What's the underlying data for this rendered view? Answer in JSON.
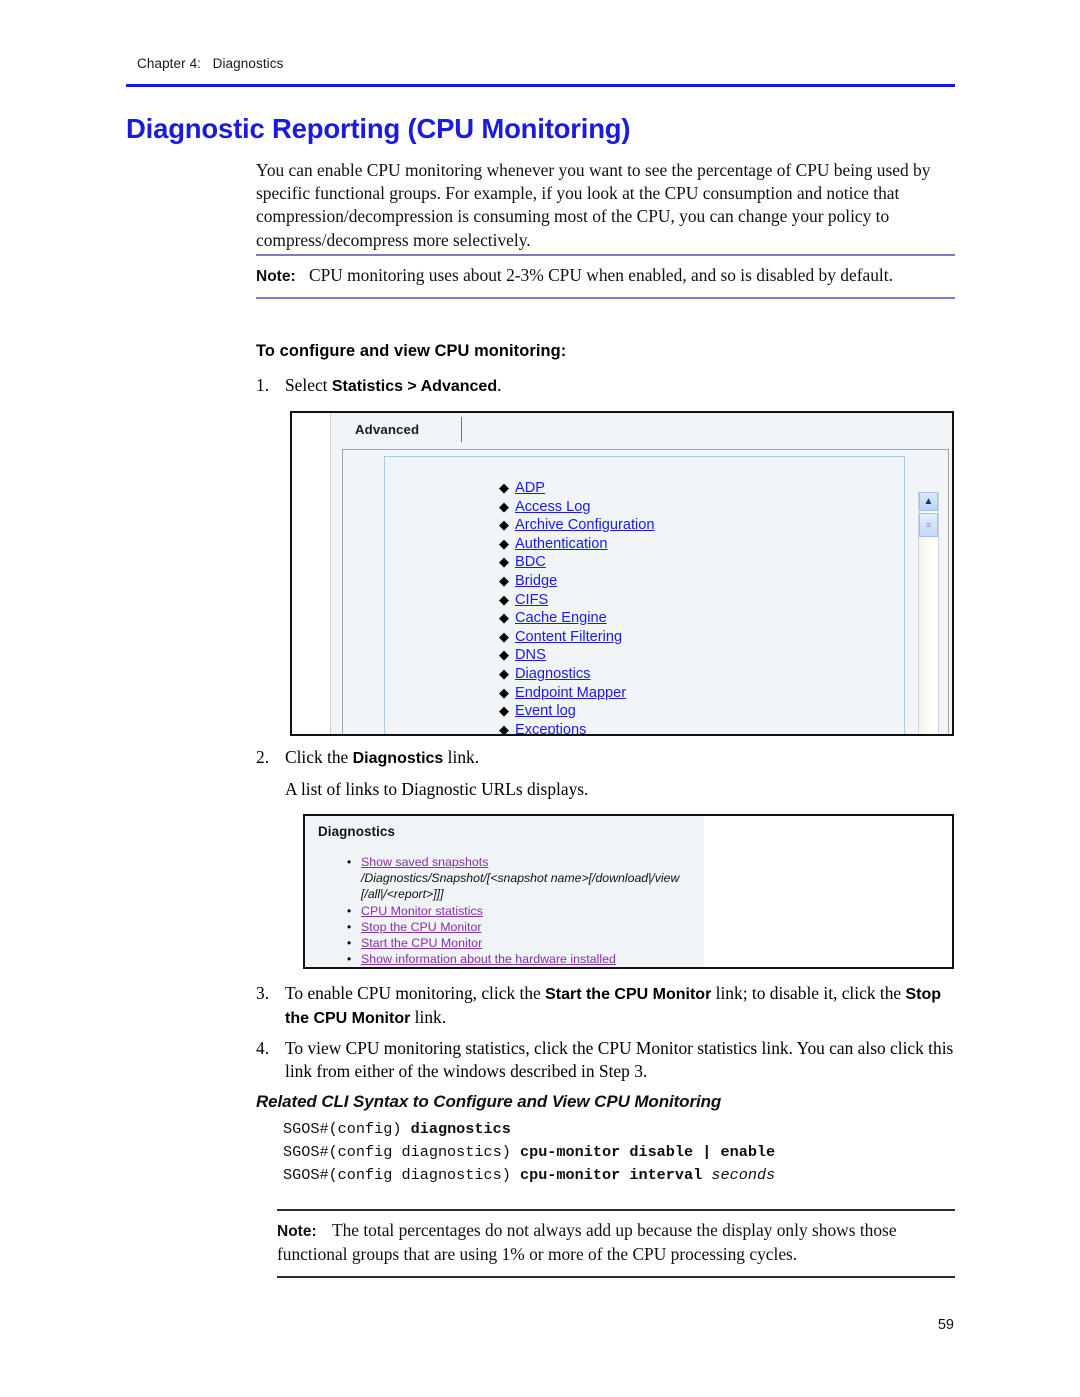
{
  "header": {
    "chapter": "Chapter 4:   Diagnostics",
    "rule_color": "#1414ef"
  },
  "title": "Diagnostic Reporting (CPU Monitoring)",
  "intro_paragraph": "You can enable CPU monitoring whenever you want to see the percentage of CPU being used by specific functional groups. For example, if you look at the CPU consumption and notice that compression/decompression is consuming most of the CPU, you can change your policy to compress/decompress more selectively.",
  "note_top": {
    "label": "Note:",
    "text": "CPU monitoring uses about 2-3% CPU when enabled, and so is disabled by default.",
    "rule_color": "#7b7bc8"
  },
  "subhead": "To configure and view CPU monitoring:",
  "steps": [
    {
      "num": "1.",
      "pre": "Select ",
      "bold": "Statistics > Advanced",
      "post": "."
    },
    {
      "num": "2.",
      "pre": "Click the ",
      "bold": "Diagnostics",
      "post": " link."
    },
    {
      "num": "3.",
      "pre": "To enable CPU monitoring, click the ",
      "bold": "Start the CPU Monitor",
      "mid": " link; to disable it, click the ",
      "bold2": "Stop the CPU Monitor",
      "post": " link."
    },
    {
      "num": "4.",
      "pre": "To view CPU monitoring statistics, click the CPU Monitor statistics link. You can also click this link from either of the windows described in Step 3.",
      "bold": "",
      "post": ""
    }
  ],
  "step2_caption": "A list of links to Diagnostic URLs displays.",
  "figure_advanced": {
    "tab_label": "Advanced",
    "link_color": "#1b1be0",
    "links": [
      "ADP",
      "Access Log",
      "Archive Configuration",
      "Authentication",
      "BDC",
      "Bridge",
      "CIFS",
      "Cache Engine",
      "Content Filtering",
      "DNS",
      "Diagnostics",
      "Endpoint Mapper",
      "Event log",
      "Exceptions"
    ],
    "scrollbar": {
      "up_glyph": "▲",
      "thumb_glyph": "≡"
    }
  },
  "figure_diagnostics": {
    "title": "Diagnostics",
    "link_color": "#8a2fa8",
    "items": [
      {
        "label": "Show saved snapshots",
        "detail_line_1": "/Diagnostics/Snapshot/[<snapshot name>[/download|/view",
        "detail_line_2": "[/all|/<report>]]]"
      },
      {
        "label": "CPU Monitor statistics",
        "detail_line_1": "",
        "detail_line_2": ""
      },
      {
        "label": "Stop the CPU Monitor",
        "detail_line_1": "",
        "detail_line_2": ""
      },
      {
        "label": "Start the CPU Monitor",
        "detail_line_1": "",
        "detail_line_2": ""
      },
      {
        "label": "Show information about the hardware installed",
        "detail_line_1": "",
        "detail_line_2": ""
      }
    ]
  },
  "cli": {
    "heading": "Related CLI Syntax to Configure and View CPU Monitoring",
    "lines": [
      {
        "prompt": "SGOS#(config) ",
        "command": "diagnostics",
        "italic": ""
      },
      {
        "prompt": "SGOS#(config diagnostics) ",
        "command": "cpu-monitor disable | enable",
        "italic": ""
      },
      {
        "prompt": "SGOS#(config diagnostics) ",
        "command": "cpu-monitor interval ",
        "italic": "seconds"
      }
    ]
  },
  "note_bottom": {
    "label": "Note:",
    "text": "The total percentages do not always add up because the display only shows those functional groups that are using 1% or more of the CPU processing cycles.",
    "rule_color": "#2c2c2c"
  },
  "page_number": "59"
}
